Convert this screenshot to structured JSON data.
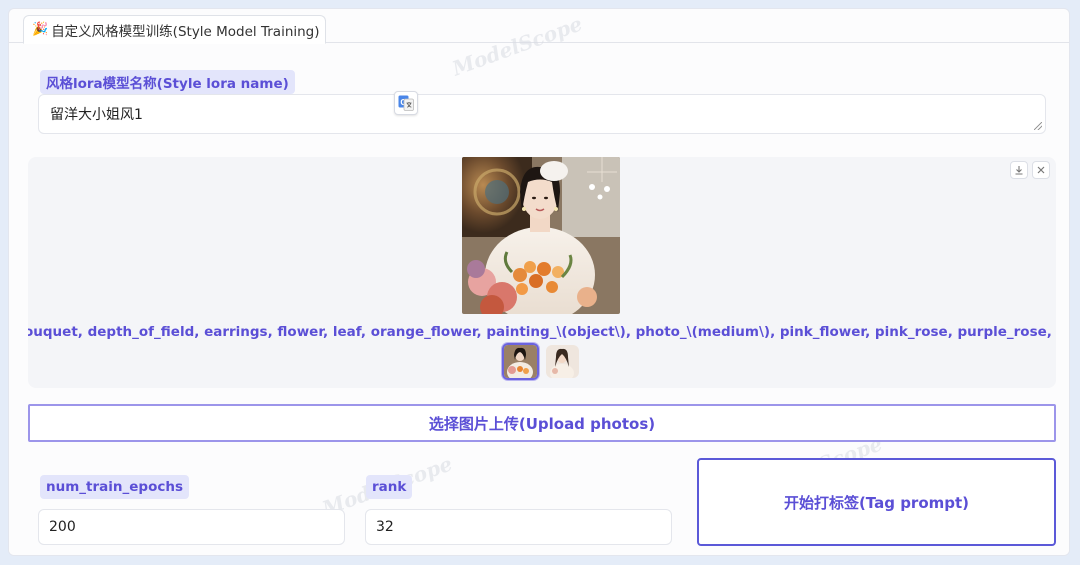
{
  "tabs": [
    {
      "emoji": "🎉",
      "label": "自定义风格模型训练(Style Model Training)"
    }
  ],
  "lora_name": {
    "label": "风格lora模型名称(Style lora name)",
    "value": "留洋大小姐风1"
  },
  "gallery": {
    "caption": "ouquet, depth_of_field, earrings, flower, leaf, orange_flower, painting_\\(object\\), photo_\\(medium\\), pink_flower, pink_rose, purple_rose, red_flower, red_rose",
    "download_icon": "download-icon",
    "close_icon": "close-icon",
    "thumbnails": 2,
    "selected_thumbnail": 1
  },
  "upload_button": "选择图片上传(Upload photos)",
  "num_train_epochs": {
    "label": "num_train_epochs",
    "value": "200"
  },
  "rank": {
    "label": "rank",
    "value": "32"
  },
  "tag_button": "开始打标签(Tag prompt)",
  "watermark": "ModelScope",
  "colors": {
    "accent": "#5b4fd6",
    "chip_bg": "#e3e5fb",
    "button_border": "#9c95ea",
    "page_bg": "#e4ecf8"
  }
}
